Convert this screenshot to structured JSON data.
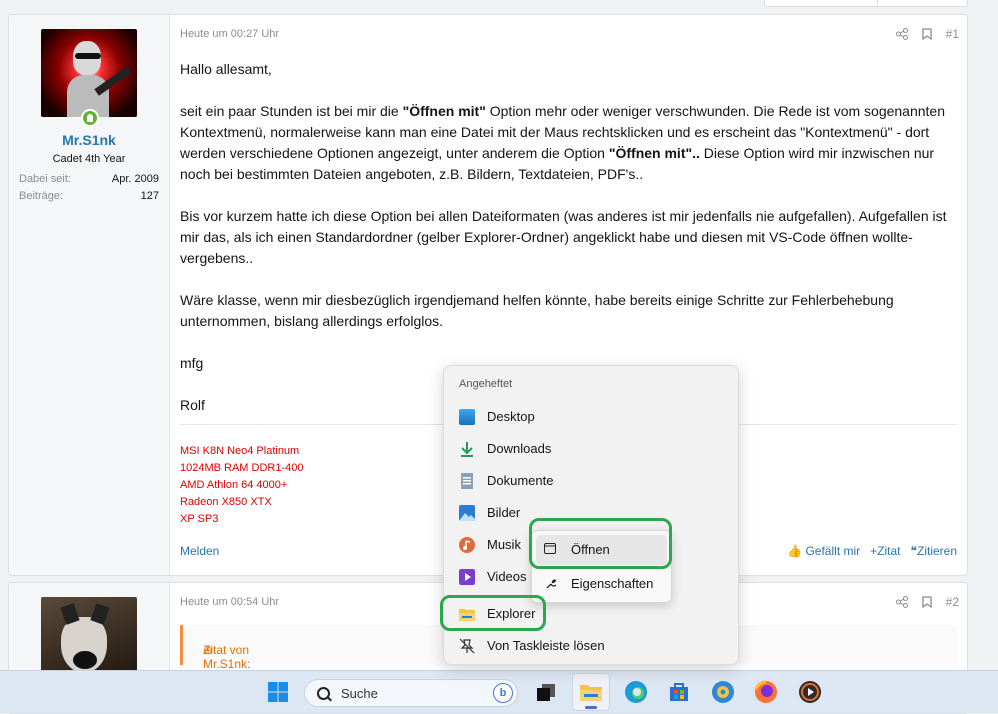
{
  "post1": {
    "user": {
      "name": "Mr.S1nk",
      "title": "Cadet 4th Year",
      "stats": [
        {
          "label": "Dabei seit:",
          "value": "Apr. 2009"
        },
        {
          "label": "Beiträge:",
          "value": "127"
        }
      ]
    },
    "date": "Heute um 00:27 Uhr",
    "number": "#1",
    "paragraphs": [
      "Hallo allesamt,",
      "seit ein paar Stunden ist bei mir die \"Öffnen mit\" Option mehr oder weniger verschwunden. Die Rede ist vom sogenannten Kontextmenü, normalerweise kann man eine Datei mit der Maus rechtsklicken und es erscheint das \"Kontextmenü\" - dort werden verschiedene Optionen angezeigt, unter anderem die Option \"Öffnen mit\".. Diese Option wird mir inzwischen nur noch bei bestimmten Dateien angeboten, z.B. Bildern, Textdateien, PDF's..",
      "Bis vor kurzem hatte ich diese Option bei allen Dateiformaten (was anderes ist mir jedenfalls nie aufgefallen). Aufgefallen ist mir das, als ich einen Standardordner (gelber Explorer-Ordner) angeklickt habe und diesen mit VS-Code öffnen wollte- vergebens..",
      "Wäre klasse, wenn mir diesbezüglich irgendjemand helfen könnte, habe bereits einige Schritte zur Fehlerbehebung unternommen, bislang allerdings erfolglos.",
      "mfg",
      "Rolf"
    ],
    "signature": [
      "MSI K8N Neo4 Platinum",
      "1024MB RAM DDR1-400",
      "AMD Athlon 64 4000+",
      "Radeon X850 XTX",
      "XP SP3"
    ],
    "report": "Melden",
    "like": "Gefällt mir",
    "quote": "Zitat",
    "cite": "Zitieren"
  },
  "post2": {
    "date": "Heute um 00:54 Uhr",
    "number": "#2",
    "quote_label": "Zitat von Mr.S1nk:"
  },
  "jumplist": {
    "header": "Angeheftet",
    "items": [
      "Desktop",
      "Downloads",
      "Dokumente",
      "Bilder",
      "Musik",
      "Videos"
    ],
    "app": "Explorer",
    "unpin": "Von Taskleiste lösen"
  },
  "submenu": {
    "open": "Öffnen",
    "properties": "Eigenschaften"
  },
  "taskbar": {
    "search_placeholder": "Suche"
  },
  "colors": {
    "accent": "#2577b1",
    "signature": "#e00000",
    "highlight": "#2aa84a"
  }
}
